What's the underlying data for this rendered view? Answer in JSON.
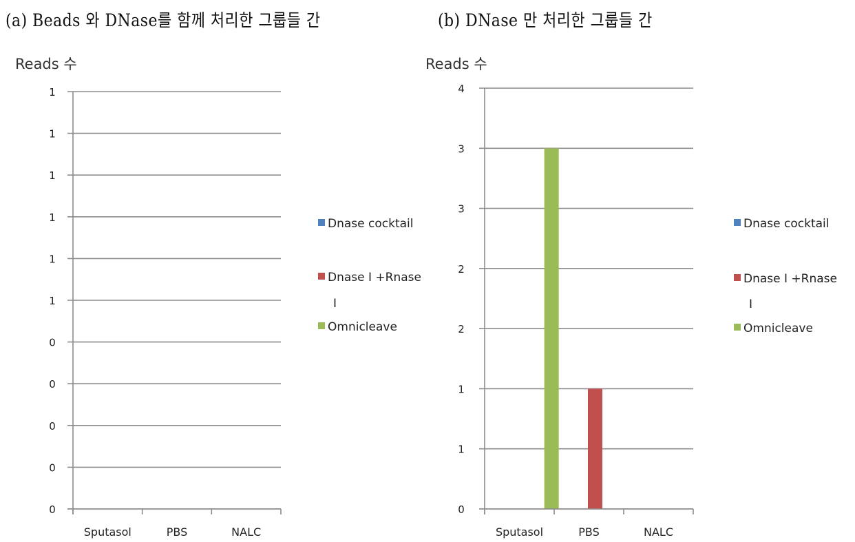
{
  "captions": {
    "a": "(a) Beads 와 DNase를 함께 처리한 그룹들 간",
    "b": "(b) DNase 만 처리한 그룹들 간"
  },
  "chart_data": [
    {
      "type": "bar",
      "title": "(a) Beads 와 DNase를 함께 처리한 그룹들 간",
      "xlabel": "",
      "ylabel": "Reads 수",
      "categories": [
        "Sputasol",
        "PBS",
        "NALC"
      ],
      "series": [
        {
          "name": "Dnase cocktail",
          "color": "#4f81bd",
          "values": [
            0,
            0,
            0
          ]
        },
        {
          "name": "Dnase I +Rnase I",
          "color": "#c0504d",
          "values": [
            0,
            0,
            0
          ]
        },
        {
          "name": "Omnicleave",
          "color": "#9bbb59",
          "values": [
            0,
            0,
            0
          ]
        }
      ],
      "ylim": [
        0,
        1
      ],
      "yticks": [
        0,
        0.1,
        0.2,
        0.3,
        0.4,
        0.5,
        0.6,
        0.7,
        0.8,
        0.9,
        1.0
      ],
      "ytick_labels": [
        "0",
        "0",
        "0",
        "0",
        "0",
        "1",
        "1",
        "1",
        "1",
        "1",
        "1"
      ],
      "grid": true,
      "legend": "right",
      "legend_labels": [
        "Dnase cocktail",
        "Dnase I +Rnase",
        "I",
        "Omnicleave"
      ]
    },
    {
      "type": "bar",
      "title": "(b) DNase 만 처리한 그룹들 간",
      "xlabel": "",
      "ylabel": "Reads 수",
      "categories": [
        "Sputasol",
        "PBS",
        "NALC"
      ],
      "series": [
        {
          "name": "Dnase cocktail",
          "color": "#4f81bd",
          "values": [
            0,
            0,
            0
          ]
        },
        {
          "name": "Dnase I +Rnase I",
          "color": "#c0504d",
          "values": [
            0,
            1,
            0
          ]
        },
        {
          "name": "Omnicleave",
          "color": "#9bbb59",
          "values": [
            3,
            0,
            0
          ]
        }
      ],
      "ylim": [
        0,
        3.5
      ],
      "yticks": [
        0,
        0.5,
        1.0,
        1.5,
        2.0,
        2.5,
        3.0,
        3.5
      ],
      "ytick_labels": [
        "0",
        "1",
        "1",
        "2",
        "2",
        "3",
        "3",
        "4"
      ],
      "grid": true,
      "legend": "right",
      "legend_labels": [
        "Dnase cocktail",
        "Dnase I +Rnase",
        "I",
        "Omnicleave"
      ]
    }
  ]
}
